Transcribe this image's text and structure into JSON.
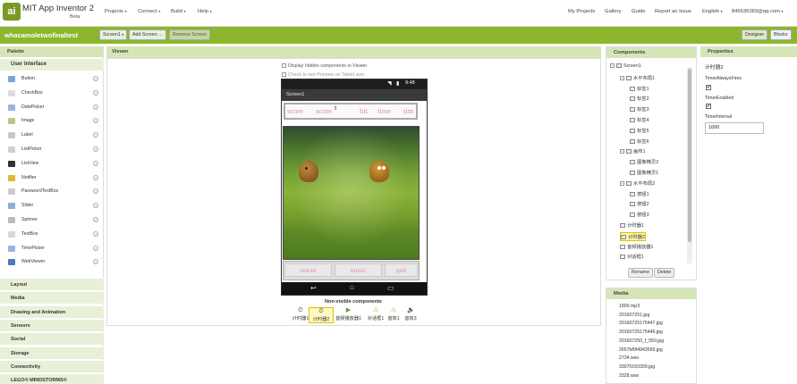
{
  "app": {
    "logo_text": "ai",
    "name": "MIT App Inventor 2",
    "badge": "Beta"
  },
  "topmenu": {
    "left": [
      {
        "label": "Projects"
      },
      {
        "label": "Connect"
      },
      {
        "label": "Build"
      },
      {
        "label": "Help"
      }
    ],
    "right": [
      {
        "label": "My Projects"
      },
      {
        "label": "Gallery"
      },
      {
        "label": "Guide"
      },
      {
        "label": "Report an Issue"
      },
      {
        "label": "English"
      },
      {
        "label": "846536383@qq.com"
      }
    ]
  },
  "projectbar": {
    "project_name": "whacamoletwofinaltest",
    "screen_select": "Screen1",
    "add_screen": "Add Screen ...",
    "remove_screen": "Remove Screen",
    "designer": "Designer",
    "blocks": "Blocks"
  },
  "palette": {
    "title": "Palette",
    "section": "User Interface",
    "items": [
      {
        "label": "Button",
        "icon": "button-icon",
        "color": "#7da2d6"
      },
      {
        "label": "CheckBox",
        "icon": "checkbox-icon",
        "color": "#dddddd"
      },
      {
        "label": "DatePicker",
        "icon": "calendar-icon",
        "color": "#9ab4e0"
      },
      {
        "label": "Image",
        "icon": "image-icon",
        "color": "#b6c98a"
      },
      {
        "label": "Label",
        "icon": "label-icon",
        "color": "#c8c8c8"
      },
      {
        "label": "ListPicker",
        "icon": "list-icon",
        "color": "#d0d0d0"
      },
      {
        "label": "ListView",
        "icon": "listview-icon",
        "color": "#333333"
      },
      {
        "label": "Notifier",
        "icon": "warning-icon",
        "color": "#e3b43a"
      },
      {
        "label": "PasswordTextBox",
        "icon": "password-icon",
        "color": "#cccccc"
      },
      {
        "label": "Slider",
        "icon": "slider-icon",
        "color": "#8ab0d8"
      },
      {
        "label": "Spinner",
        "icon": "spinner-icon",
        "color": "#bbbbbb"
      },
      {
        "label": "TextBox",
        "icon": "textbox-icon",
        "color": "#d8d8d8"
      },
      {
        "label": "TimePicker",
        "icon": "clock-icon",
        "color": "#9ab4e0"
      },
      {
        "label": "WebViewer",
        "icon": "globe-icon",
        "color": "#4a7abf"
      }
    ],
    "categories": [
      {
        "label": "Layout"
      },
      {
        "label": "Media"
      },
      {
        "label": "Drawing and Animation"
      },
      {
        "label": "Sensors"
      },
      {
        "label": "Social"
      },
      {
        "label": "Storage"
      },
      {
        "label": "Connectivity"
      },
      {
        "label": "LEGO® MINDSTORMS®"
      }
    ]
  },
  "viewer": {
    "title": "Viewer",
    "display_hidden": "Display hidden components in Viewer",
    "tablet_preview": "Check to see Preview on Tablet size.",
    "status_time": "9:48",
    "screen_title": "Screen1",
    "score_row": [
      "score",
      "score",
      "hit",
      "time",
      "tim"
    ],
    "score_overlay": "t",
    "buttons": [
      "restart",
      "music",
      "quit"
    ],
    "nonvisible_title": "Non-visible components",
    "nonvisible": [
      {
        "label": "计时器1",
        "icon": "clock-icon"
      },
      {
        "label": "计时器2",
        "icon": "clock-icon"
      },
      {
        "label": "音频播放器1",
        "icon": "play-icon"
      },
      {
        "label": "对话框1",
        "icon": "warning-icon"
      },
      {
        "label": "音效1",
        "icon": "warning-icon"
      },
      {
        "label": "音效3",
        "icon": "sound-icon"
      }
    ]
  },
  "components": {
    "title": "Components",
    "tree": [
      {
        "label": "Screen1",
        "depth": 0,
        "toggle": "−"
      },
      {
        "label": "水平布局1",
        "depth": 1,
        "toggle": "−"
      },
      {
        "label": "标签1",
        "depth": 2
      },
      {
        "label": "标签2",
        "depth": 2
      },
      {
        "label": "标签3",
        "depth": 2
      },
      {
        "label": "标签4",
        "depth": 2
      },
      {
        "label": "标签5",
        "depth": 2
      },
      {
        "label": "标签6",
        "depth": 2
      },
      {
        "label": "画布1",
        "depth": 1,
        "toggle": "−"
      },
      {
        "label": "图像精灵2",
        "depth": 2
      },
      {
        "label": "图像精灵1",
        "depth": 2
      },
      {
        "label": "水平布局2",
        "depth": 1,
        "toggle": "−"
      },
      {
        "label": "按钮1",
        "depth": 2
      },
      {
        "label": "按钮2",
        "depth": 2
      },
      {
        "label": "按钮3",
        "depth": 2
      },
      {
        "label": "计时器1",
        "depth": 1
      },
      {
        "label": "计时器2",
        "depth": 1,
        "selected": true
      },
      {
        "label": "音频播放器1",
        "depth": 1
      },
      {
        "label": "对话框1",
        "depth": 1
      }
    ],
    "rename": "Rename",
    "delete": "Delete"
  },
  "media": {
    "title": "Media",
    "items": [
      "1800.mp3",
      "201607251.jpg",
      "20160725175447.jpg",
      "20160725175446.jpg",
      "201607250_f_550.jpg",
      "2657bf0f4943565.jpg",
      "2734.wav",
      "33070150309.jpg",
      "3328.wav"
    ]
  },
  "properties": {
    "title": "Properties",
    "component": "计时器2",
    "timer_always_fires": "TimerAlwaysFires",
    "timer_enabled": "TimerEnabled",
    "timer_interval": "TimerInterval",
    "timer_interval_value": "1000",
    "checkmark": "✔"
  }
}
